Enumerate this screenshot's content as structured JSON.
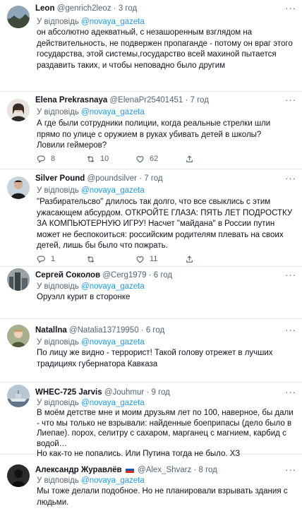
{
  "reply_prefix": "У відповідь",
  "reply_to": "@novaya_gazeta",
  "dot": "·",
  "more": "···",
  "tweets": [
    {
      "name": "Leon",
      "handle": "@genrich2leoz",
      "time": "3 год",
      "text": "он абсолютно адекватный, с незашоренным взглядом на действительность, не подвержен пропаганде - потому он враг этого государства, этой системы,государство всей махиной пытается раздавить таких, и чтобы неповадно было другим",
      "icon": "landscape-avatar"
    },
    {
      "name": "Elena Prekrasnaya",
      "handle": "@ElenaPr25401451",
      "time": "7 год",
      "text": "А где были сотрудники полиции, когда реальные стрелки шли прямо по улице с оружием в руках убивать детей в школы?\nЛовили геймеров?",
      "reply_count": "8",
      "retweet_count": "10",
      "like_count": "62",
      "icon": "woman-avatar"
    },
    {
      "name": "Silver Pound",
      "handle": "@poundsilver",
      "time": "7 год",
      "text": "\"Разбирательсво\" длилось так долго, что все свыклись с этим ужасающем абсурдом. ОТКРОЙТЕ ГЛАЗА: ПЯТЬ  ЛЕТ ПОДРОСТКУ ЗА КОМПЬЮТЕРНУЮ ИГРУ! Насчет \"майдана\" в России путин может не беспокоиться: российским родителям плевать на своих детей, лишь бы было что пожрать.",
      "reply_count": "1",
      "retweet_count": "",
      "like_count": "11",
      "icon": "man-avatar"
    },
    {
      "name": "Сергей Соколов",
      "handle": "@Cerg1979",
      "time": "6 год",
      "text": "Оруэлл курит в сторонке",
      "icon": "city-avatar"
    },
    {
      "name": "Natallna",
      "handle": "@Natalia13719950",
      "time": "6 год",
      "text": "По лицу же видно - террорист! Такой голову отрежет в лучших традициях губернатора Кавказа",
      "icon": "portrait-avatar"
    },
    {
      "name": "WHEC-725 Jarvis",
      "handle": "@Jouhmur",
      "time": "9 год",
      "text": "В моём детстве мне и моим друзьям лет по 100, наверное, бы дали - что мы только не взрывали: найденные боеприпасы (дело было в Лиепае). порох, селитру с сахаром, марганец с магнием, карбид с водой…\nНо как-то не попались. Или Путина тогда не было. ХЗ",
      "icon": "ship-avatar"
    },
    {
      "name": "Александр Журавлёв",
      "handle": "@Alex_Shvarz",
      "time": "8 год",
      "text": "Мы тоже делали подобное. Но не планировали взрывать здания с людьми.",
      "icon": "silhouette-avatar"
    }
  ],
  "colors": {
    "text": "#0f1419",
    "muted": "#536471",
    "link": "#1d9bf0",
    "divider": "#e7e9ea"
  }
}
